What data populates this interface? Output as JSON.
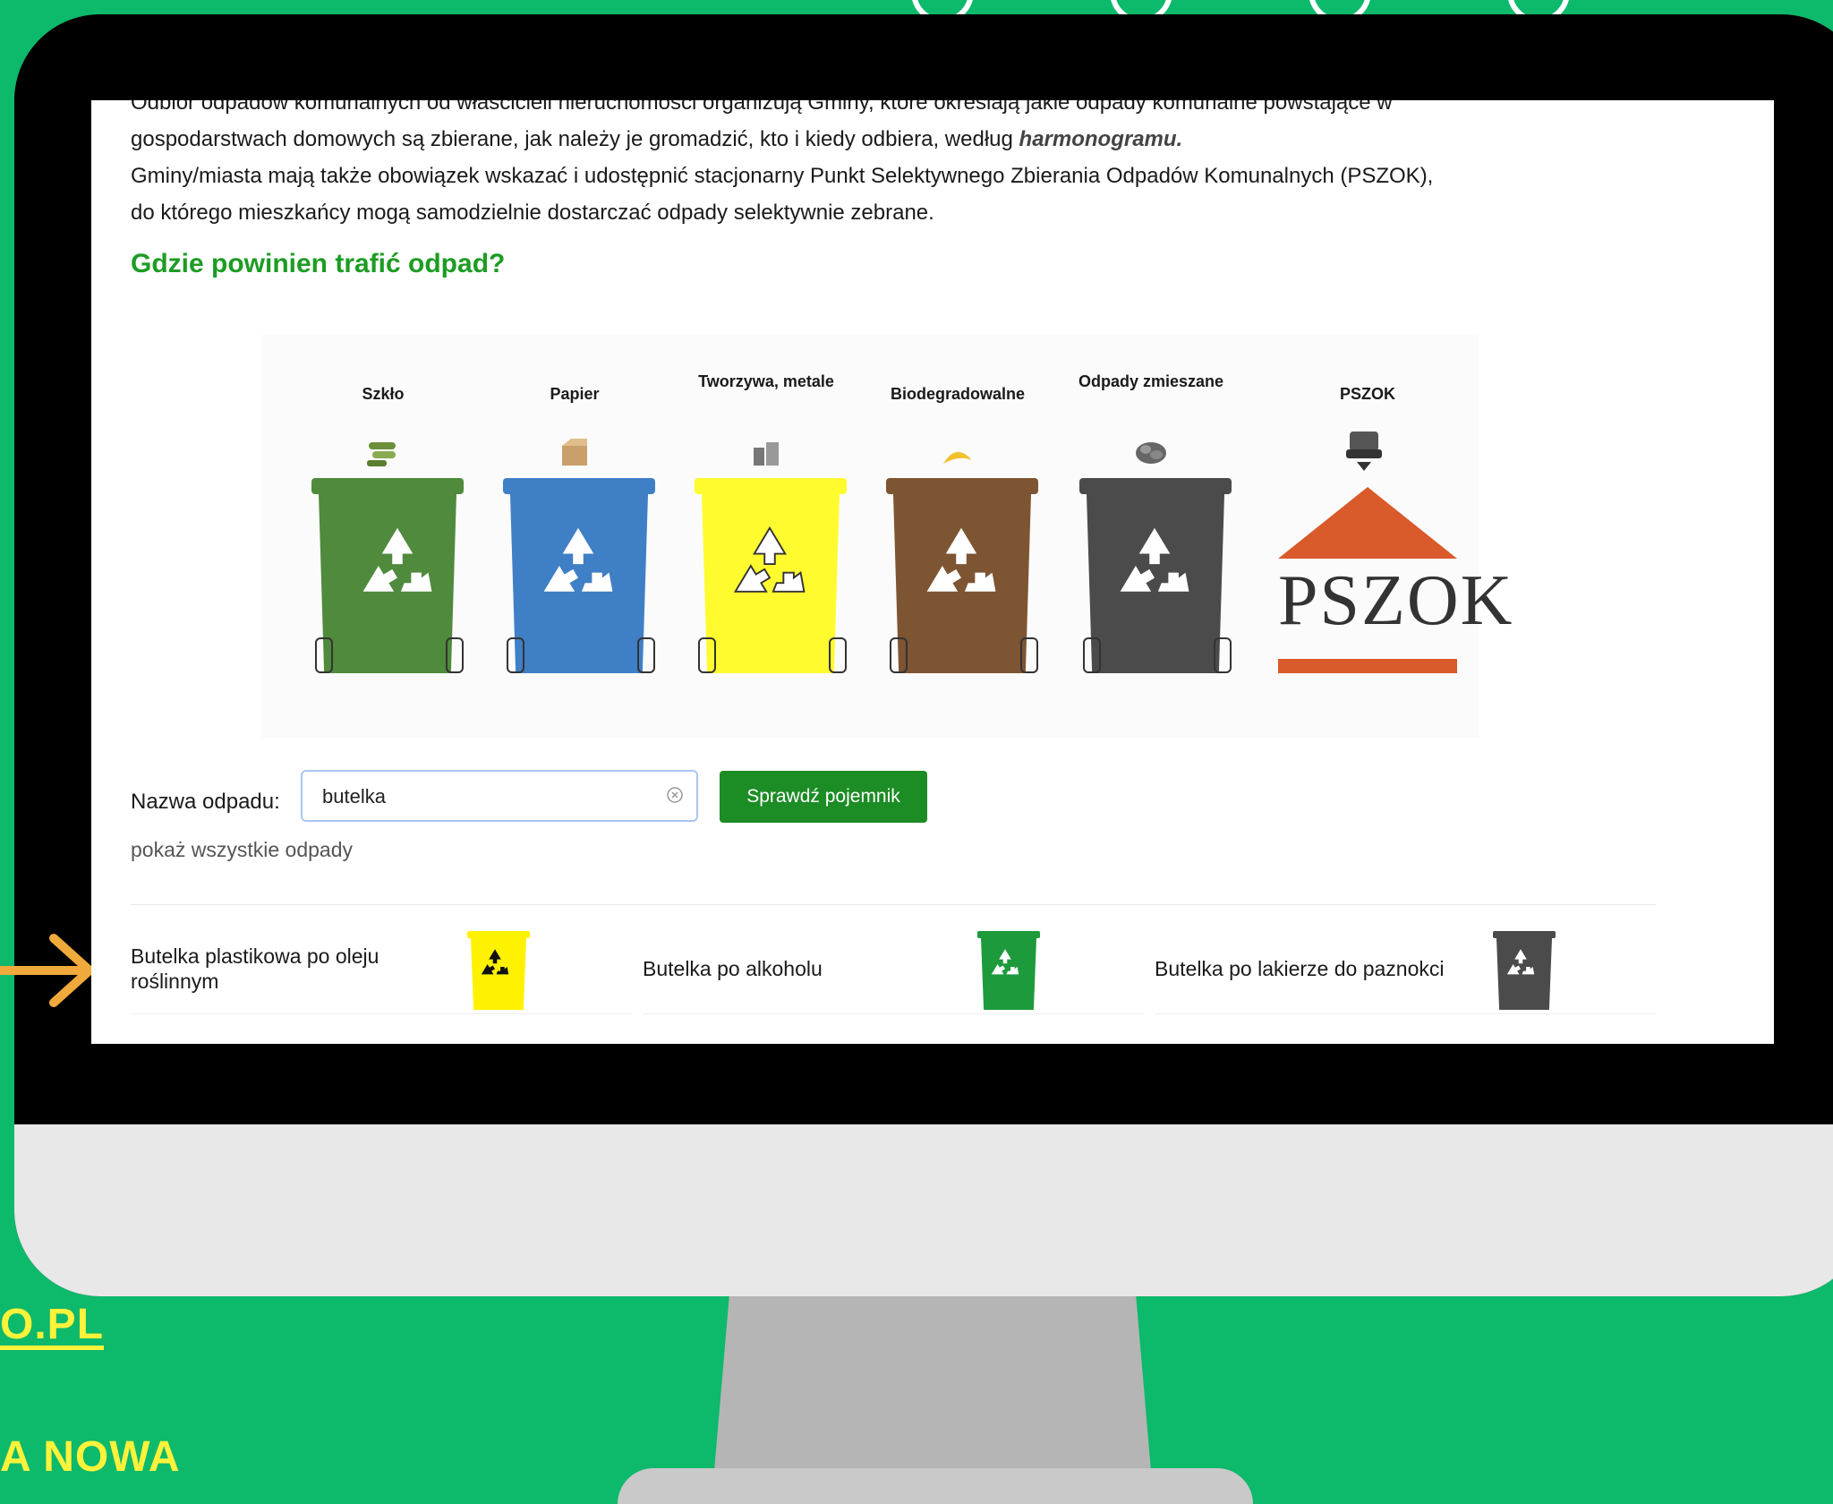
{
  "colors": {
    "background": "#0db96b",
    "accent_yellow": "#fff23a",
    "heading_green": "#1c9c23",
    "button_green": "#1c8c24",
    "arrow": "#f0a93b"
  },
  "side": {
    "url_fragment": "O.PL",
    "bottom_fragment": "A NOWA"
  },
  "article": {
    "line1": "Odbiór odpadów komunalnych od właścicieli nieruchomości organizują Gminy, które określają jakie odpady komunalne powstające w",
    "line2_text": "gospodarstwach domowych są zbierane, jak należy je gromadzić, kto i kiedy odbiera, według ",
    "line2_link": "harmonogramu.",
    "line3": "Gminy/miasta mają także obowiązek wskazać i udostępnić stacjonarny Punkt Selektywnego Zbierania Odpadów Komunalnych (PSZOK),",
    "line4": "do którego mieszkańcy mogą samodzielnie dostarczać odpady selektywnie zebrane.",
    "heading": "Gdzie powinien trafić odpad?"
  },
  "bins": [
    {
      "label": "Szkło",
      "color": "#4f8a3d",
      "icon": "glass-bottles-icon"
    },
    {
      "label": "Papier",
      "color": "#3f7fc6",
      "icon": "cardboard-box-icon"
    },
    {
      "label": "Tworzywa, metale",
      "color": "#fffb2f",
      "icon": "cans-icon"
    },
    {
      "label": "Biodegradowalne",
      "color": "#7e5532",
      "icon": "banana-peel-icon"
    },
    {
      "label": "Odpady zmieszane",
      "color": "#4b4b4b",
      "icon": "mixed-waste-icon"
    },
    {
      "label": "PSZOK",
      "color": "#d95a2b",
      "word": "PSZOK",
      "icon": "armchair-icon"
    }
  ],
  "search": {
    "label": "Nazwa odpadu:",
    "value": "butelka",
    "button": "Sprawdź pojemnik",
    "show_all": "pokaż wszystkie odpady"
  },
  "results": [
    {
      "name": "Butelka plastikowa po oleju roślinnym",
      "bin_color": "#fff200"
    },
    {
      "name": "Butelka po alkoholu",
      "bin_color": "#1d9a3c"
    },
    {
      "name": "Butelka po lakierze do paznokci",
      "bin_color": "#4b4b4b"
    }
  ]
}
